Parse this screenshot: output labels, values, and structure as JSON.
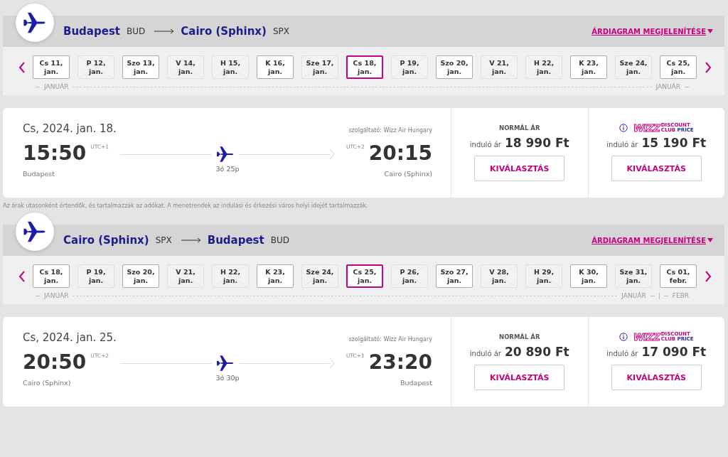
{
  "legs": [
    {
      "origin": {
        "city": "Budapest",
        "code": "BUD"
      },
      "destination": {
        "city": "Cairo (Sphinx)",
        "code": "SPX"
      },
      "chart_link": "ÁRDIAGRAM MEGJELENÍTÉSE",
      "dates": [
        {
          "label": "Cs 11,",
          "month": "jan.",
          "available": true,
          "selected": false
        },
        {
          "label": "P 12,",
          "month": "jan.",
          "available": false,
          "selected": false
        },
        {
          "label": "Szo 13,",
          "month": "jan.",
          "available": true,
          "selected": false
        },
        {
          "label": "V 14,",
          "month": "jan.",
          "available": false,
          "selected": false
        },
        {
          "label": "H 15,",
          "month": "jan.",
          "available": false,
          "selected": false
        },
        {
          "label": "K 16,",
          "month": "jan.",
          "available": true,
          "selected": false
        },
        {
          "label": "Sze 17,",
          "month": "jan.",
          "available": false,
          "selected": false
        },
        {
          "label": "Cs 18,",
          "month": "jan.",
          "available": true,
          "selected": true
        },
        {
          "label": "P 19,",
          "month": "jan.",
          "available": false,
          "selected": false
        },
        {
          "label": "Szo 20,",
          "month": "jan.",
          "available": true,
          "selected": false
        },
        {
          "label": "V 21,",
          "month": "jan.",
          "available": false,
          "selected": false
        },
        {
          "label": "H 22,",
          "month": "jan.",
          "available": false,
          "selected": false
        },
        {
          "label": "K 23,",
          "month": "jan.",
          "available": true,
          "selected": false
        },
        {
          "label": "Sze 24,",
          "month": "jan.",
          "available": false,
          "selected": false
        },
        {
          "label": "Cs 25,",
          "month": "jan.",
          "available": true,
          "selected": false
        }
      ],
      "months": [
        "JANUÁR",
        "JANUÁR"
      ],
      "flight": {
        "date": "Cs, 2024. jan. 18.",
        "operator": "szolgáltató: Wizz Air Hungary",
        "departure": {
          "time": "15:50",
          "utc": "UTC+1",
          "city": "Budapest"
        },
        "arrival": {
          "time": "20:15",
          "utc": "UTC+2",
          "city": "Cairo (Sphinx)"
        },
        "duration": "3ó 25p"
      },
      "fares": [
        {
          "kind": "normal",
          "title": "NORMÁL ÁR",
          "from": "induló ár",
          "price": "18 990 Ft",
          "button": "KIVÁLASZTÁS"
        },
        {
          "kind": "club",
          "logo": {
            "brand": "WIZZ",
            "line1": "DISCOUNT",
            "line2a": "CLUB",
            "line2b": "PRICE"
          },
          "from": "induló ár",
          "price": "15 190 Ft",
          "button": "KIVÁLASZTÁS"
        }
      ],
      "note": "Az árak utasonként értendők, és tartalmazzák az adókat. A menetrendek az indulási és érkezési város helyi idejét tartalmazzák."
    },
    {
      "origin": {
        "city": "Cairo (Sphinx)",
        "code": "SPX"
      },
      "destination": {
        "city": "Budapest",
        "code": "BUD"
      },
      "chart_link": "ÁRDIAGRAM MEGJELENÍTÉSE",
      "dates": [
        {
          "label": "Cs 18,",
          "month": "jan.",
          "available": true,
          "selected": false
        },
        {
          "label": "P 19,",
          "month": "jan.",
          "available": false,
          "selected": false
        },
        {
          "label": "Szo 20,",
          "month": "jan.",
          "available": true,
          "selected": false
        },
        {
          "label": "V 21,",
          "month": "jan.",
          "available": false,
          "selected": false
        },
        {
          "label": "H 22,",
          "month": "jan.",
          "available": false,
          "selected": false
        },
        {
          "label": "K 23,",
          "month": "jan.",
          "available": true,
          "selected": false
        },
        {
          "label": "Sze 24,",
          "month": "jan.",
          "available": false,
          "selected": false
        },
        {
          "label": "Cs 25,",
          "month": "jan.",
          "available": true,
          "selected": true
        },
        {
          "label": "P 26,",
          "month": "jan.",
          "available": false,
          "selected": false
        },
        {
          "label": "Szo 27,",
          "month": "jan.",
          "available": true,
          "selected": false
        },
        {
          "label": "V 28,",
          "month": "jan.",
          "available": false,
          "selected": false
        },
        {
          "label": "H 29,",
          "month": "jan.",
          "available": false,
          "selected": false
        },
        {
          "label": "K 30,",
          "month": "jan.",
          "available": true,
          "selected": false
        },
        {
          "label": "Sze 31,",
          "month": "jan.",
          "available": false,
          "selected": false
        },
        {
          "label": "Cs 01,",
          "month": "febr.",
          "available": true,
          "selected": false
        }
      ],
      "months": [
        "JANUÁR",
        "JANUÁR",
        "FEBR"
      ],
      "flight": {
        "date": "Cs, 2024. jan. 25.",
        "operator": "szolgáltató: Wizz Air Hungary",
        "departure": {
          "time": "20:50",
          "utc": "UTC+2",
          "city": "Cairo (Sphinx)"
        },
        "arrival": {
          "time": "23:20",
          "utc": "UTC+1",
          "city": "Budapest"
        },
        "duration": "3ó 30p"
      },
      "fares": [
        {
          "kind": "normal",
          "title": "NORMÁL ÁR",
          "from": "induló ár",
          "price": "20 890 Ft",
          "button": "KIVÁLASZTÁS"
        },
        {
          "kind": "club",
          "logo": {
            "brand": "WIZZ",
            "line1": "DISCOUNT",
            "line2a": "CLUB",
            "line2b": "PRICE"
          },
          "from": "induló ár",
          "price": "17 090 Ft",
          "button": "KIVÁLASZTÁS"
        }
      ]
    }
  ]
}
